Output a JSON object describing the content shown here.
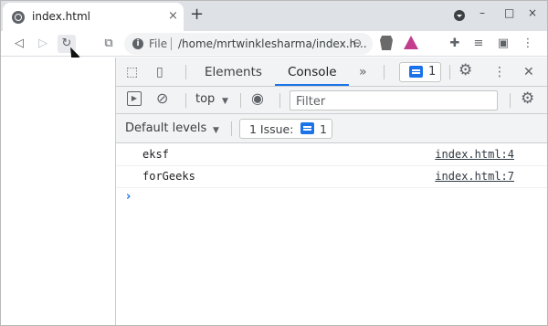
{
  "browser": {
    "tab": {
      "title": "index.html",
      "close_icon": "×"
    },
    "new_tab_icon": "+",
    "window_controls": {
      "minimize": "–",
      "maximize": "□",
      "close": "×"
    },
    "nav": {
      "back": "◁",
      "forward": "▷",
      "reload": "↻",
      "bookmark": "⧉"
    },
    "omnibox": {
      "scheme_label": "File",
      "url": "/home/mrtwinklesharma/index.h...",
      "zoom_icon": "⊖"
    },
    "toolbar_icons": {
      "extensions": "✚",
      "reading_list": "≡",
      "wallet": "▣",
      "menu": "⋮"
    }
  },
  "devtools": {
    "tabs": [
      {
        "label": "Elements",
        "active": false
      },
      {
        "label": "Console",
        "active": true
      }
    ],
    "more_tabs_icon": "»",
    "issues_badge_count": "1",
    "settings_icon": "⚙",
    "more_icon": "⋮",
    "close_icon": "✕",
    "console_toolbar": {
      "sidebar_icon": "▶",
      "clear_icon": "⊘",
      "context": "top",
      "context_arrow": "▼",
      "eye_icon": "◉",
      "filter_placeholder": "Filter",
      "settings_icon": "⚙"
    },
    "levels_bar": {
      "levels_label": "Default levels",
      "levels_arrow": "▼",
      "issue_label": "1 Issue:",
      "issue_count": "1"
    },
    "messages": [
      {
        "text": "eksf",
        "source": "index.html:4"
      },
      {
        "text": "forGeeks",
        "source": "index.html:7"
      }
    ],
    "prompt_symbol": "›"
  },
  "colors": {
    "accent": "#1a73e8",
    "toolbar_bg": "#f1f3f4",
    "tabstrip_bg": "#dee1e6"
  }
}
